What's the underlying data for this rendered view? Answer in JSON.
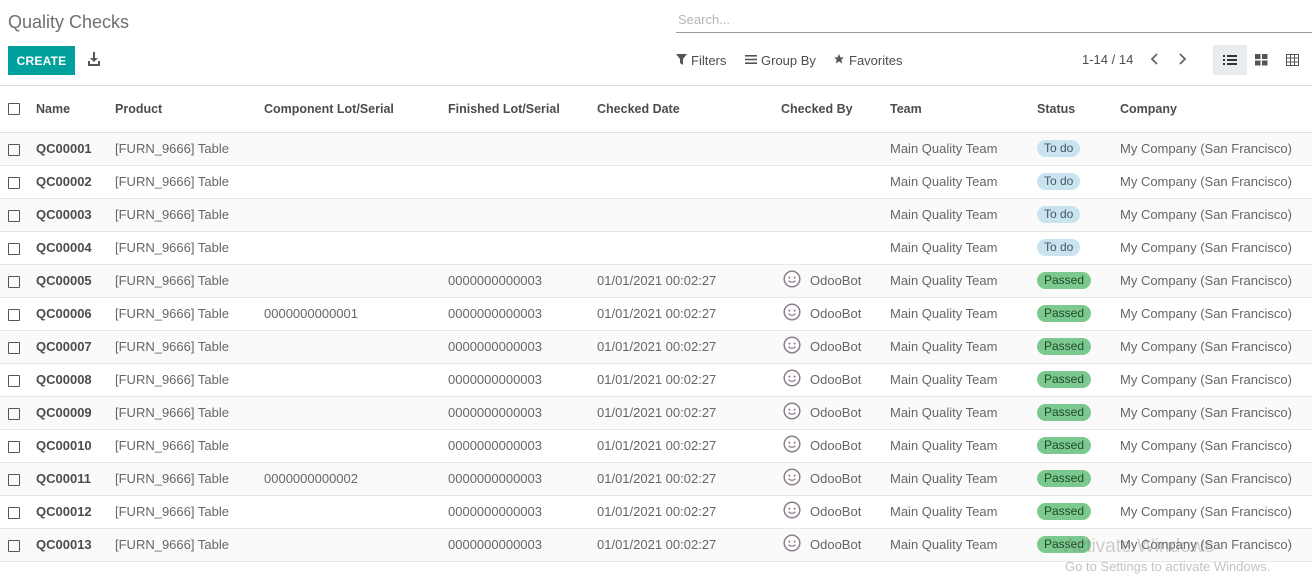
{
  "page": {
    "title": "Quality Checks",
    "create_label": "CREATE",
    "search_placeholder": "Search..."
  },
  "toolbar": {
    "filters_label": "Filters",
    "groupby_label": "Group By",
    "favorites_label": "Favorites",
    "pager": "1-14 / 14"
  },
  "table": {
    "headers": {
      "name": "Name",
      "product": "Product",
      "component_lot": "Component Lot/Serial",
      "finished_lot": "Finished Lot/Serial",
      "checked_date": "Checked Date",
      "checked_by": "Checked By",
      "team": "Team",
      "status": "Status",
      "company": "Company"
    },
    "rows": [
      {
        "name": "QC00001",
        "product": "[FURN_9666] Table",
        "component_lot": "",
        "finished_lot": "",
        "checked_date": "",
        "checked_by": "",
        "team": "Main Quality Team",
        "status": "To do",
        "company": "My Company (San Francisco)"
      },
      {
        "name": "QC00002",
        "product": "[FURN_9666] Table",
        "component_lot": "",
        "finished_lot": "",
        "checked_date": "",
        "checked_by": "",
        "team": "Main Quality Team",
        "status": "To do",
        "company": "My Company (San Francisco)"
      },
      {
        "name": "QC00003",
        "product": "[FURN_9666] Table",
        "component_lot": "",
        "finished_lot": "",
        "checked_date": "",
        "checked_by": "",
        "team": "Main Quality Team",
        "status": "To do",
        "company": "My Company (San Francisco)"
      },
      {
        "name": "QC00004",
        "product": "[FURN_9666] Table",
        "component_lot": "",
        "finished_lot": "",
        "checked_date": "",
        "checked_by": "",
        "team": "Main Quality Team",
        "status": "To do",
        "company": "My Company (San Francisco)"
      },
      {
        "name": "QC00005",
        "product": "[FURN_9666] Table",
        "component_lot": "",
        "finished_lot": "0000000000003",
        "checked_date": "01/01/2021 00:02:27",
        "checked_by": "OdooBot",
        "team": "Main Quality Team",
        "status": "Passed",
        "company": "My Company (San Francisco)"
      },
      {
        "name": "QC00006",
        "product": "[FURN_9666] Table",
        "component_lot": "0000000000001",
        "finished_lot": "0000000000003",
        "checked_date": "01/01/2021 00:02:27",
        "checked_by": "OdooBot",
        "team": "Main Quality Team",
        "status": "Passed",
        "company": "My Company (San Francisco)"
      },
      {
        "name": "QC00007",
        "product": "[FURN_9666] Table",
        "component_lot": "",
        "finished_lot": "0000000000003",
        "checked_date": "01/01/2021 00:02:27",
        "checked_by": "OdooBot",
        "team": "Main Quality Team",
        "status": "Passed",
        "company": "My Company (San Francisco)"
      },
      {
        "name": "QC00008",
        "product": "[FURN_9666] Table",
        "component_lot": "",
        "finished_lot": "0000000000003",
        "checked_date": "01/01/2021 00:02:27",
        "checked_by": "OdooBot",
        "team": "Main Quality Team",
        "status": "Passed",
        "company": "My Company (San Francisco)"
      },
      {
        "name": "QC00009",
        "product": "[FURN_9666] Table",
        "component_lot": "",
        "finished_lot": "0000000000003",
        "checked_date": "01/01/2021 00:02:27",
        "checked_by": "OdooBot",
        "team": "Main Quality Team",
        "status": "Passed",
        "company": "My Company (San Francisco)"
      },
      {
        "name": "QC00010",
        "product": "[FURN_9666] Table",
        "component_lot": "",
        "finished_lot": "0000000000003",
        "checked_date": "01/01/2021 00:02:27",
        "checked_by": "OdooBot",
        "team": "Main Quality Team",
        "status": "Passed",
        "company": "My Company (San Francisco)"
      },
      {
        "name": "QC00011",
        "product": "[FURN_9666] Table",
        "component_lot": "0000000000002",
        "finished_lot": "0000000000003",
        "checked_date": "01/01/2021 00:02:27",
        "checked_by": "OdooBot",
        "team": "Main Quality Team",
        "status": "Passed",
        "company": "My Company (San Francisco)"
      },
      {
        "name": "QC00012",
        "product": "[FURN_9666] Table",
        "component_lot": "",
        "finished_lot": "0000000000003",
        "checked_date": "01/01/2021 00:02:27",
        "checked_by": "OdooBot",
        "team": "Main Quality Team",
        "status": "Passed",
        "company": "My Company (San Francisco)"
      },
      {
        "name": "QC00013",
        "product": "[FURN_9666] Table",
        "component_lot": "",
        "finished_lot": "0000000000003",
        "checked_date": "01/01/2021 00:02:27",
        "checked_by": "OdooBot",
        "team": "Main Quality Team",
        "status": "Passed",
        "company": "My Company (San Francisco)"
      }
    ]
  },
  "watermark": {
    "line1": "Activate Windows",
    "line2": "Go to Settings to activate Windows."
  },
  "colors": {
    "primary": "#00a09d",
    "todo_badge": "#c9e3ef",
    "passed_badge": "#7bc98f"
  },
  "icons": {
    "download": "download-icon",
    "filter": "filter-icon",
    "group_by": "list-bars-icon",
    "favorites": "star-icon",
    "prev": "chevron-left-icon",
    "next": "chevron-right-icon",
    "list_view": "list-view-icon",
    "kanban_view": "kanban-view-icon",
    "pivot_view": "table-view-icon",
    "avatar": "smiley-avatar-icon"
  }
}
